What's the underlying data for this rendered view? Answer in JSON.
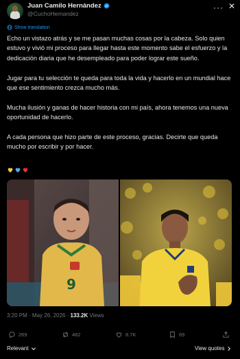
{
  "author": {
    "display_name": "Juan Camilo Hernández",
    "handle": "@CuchoHernandez",
    "verified": true
  },
  "controls": {
    "more_label": "···",
    "close_label": "✕"
  },
  "translate_label": "Show translation",
  "post": {
    "paragraphs": [
      "Echo un vistazo atrás y se me pasan muchas cosas por la cabeza. Solo quien estuvo y vivió mi proceso para llegar hasta este momento sabe el esfuerzo y la dedicación diaria que he desempleado para poder lograr este sueño.",
      "Jugar para tu selección te queda para toda la vida y hacerlo en un mundial hace que ese sentimiento crezca mucho más.",
      "Mucha ilusión y ganas de hacer historia con mi país, ahora tenemos una nueva oportunidad de hacerlo.",
      "A cada persona que hizo parte de este proceso, gracias. Decirte que queda mucho por escribir y por hacer."
    ],
    "hearts": [
      "yellow-heart",
      "blue-heart",
      "red-heart"
    ],
    "heart_colors": [
      "#f7c844",
      "#5aa7e6",
      "#e0323b"
    ]
  },
  "media": {
    "left_photo": "childhood-photo",
    "right_photo": "player-photo",
    "left_jersey_number": "9"
  },
  "meta": {
    "time": "3:20 PM",
    "separator": " · ",
    "date": "May 26, 2026",
    "views_count": "133.2K",
    "views_label": " Views"
  },
  "actions": {
    "replies": "269",
    "reposts": "482",
    "likes": "8.7K",
    "bookmarks": "69"
  },
  "footer": {
    "sort_label": "Relevant",
    "view_quotes_label": "View quotes"
  },
  "colors": {
    "accent": "#1d9bf0",
    "muted": "#71767b",
    "text": "#e7e9ea",
    "background": "#000000"
  }
}
